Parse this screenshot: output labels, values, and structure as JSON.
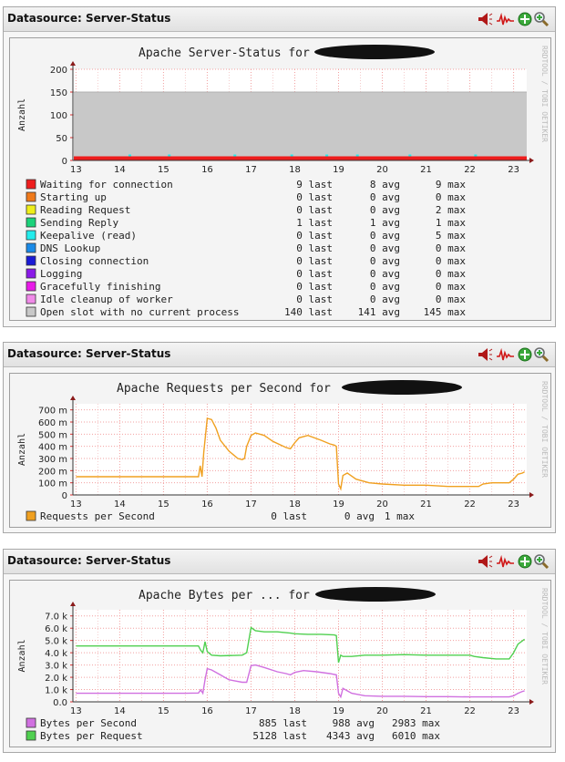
{
  "panels": [
    {
      "title": "Datasource: Server-Status",
      "graph_title": "Apache Server-Status for ",
      "watermark": "RRDTOOL / TOBI OETIKER",
      "chart_data": {
        "type": "area",
        "title": "Apache Server-Status for ",
        "ylabel": "Anzahl",
        "x_ticks": [
          "13",
          "14",
          "15",
          "16",
          "17",
          "18",
          "19",
          "20",
          "21",
          "22",
          "23"
        ],
        "y_ticks": [
          "0",
          "50",
          "100",
          "150",
          "200"
        ],
        "ylim": [
          0,
          200
        ],
        "grid": true,
        "series": [
          {
            "name": "Waiting for connection",
            "color": "#ee1d1d",
            "last": "9",
            "avg": "8",
            "max": "9"
          },
          {
            "name": "Starting up",
            "color": "#f07a1a",
            "last": "0",
            "avg": "0",
            "max": "0"
          },
          {
            "name": "Reading Request",
            "color": "#eeee1a",
            "last": "0",
            "avg": "0",
            "max": "2"
          },
          {
            "name": "Sending Reply",
            "color": "#1ad27a",
            "last": "1",
            "avg": "1",
            "max": "1"
          },
          {
            "name": "Keepalive (read)",
            "color": "#22ecec",
            "last": "0",
            "avg": "0",
            "max": "5"
          },
          {
            "name": "DNS Lookup",
            "color": "#1a8ae8",
            "last": "0",
            "avg": "0",
            "max": "0"
          },
          {
            "name": "Closing connection",
            "color": "#1a1ad6",
            "last": "0",
            "avg": "0",
            "max": "0"
          },
          {
            "name": "Logging",
            "color": "#8a1ae8",
            "last": "0",
            "avg": "0",
            "max": "0"
          },
          {
            "name": "Gracefully finishing",
            "color": "#e81ae8",
            "last": "0",
            "avg": "0",
            "max": "0"
          },
          {
            "name": "Idle cleanup of worker",
            "color": "#f08ae8",
            "last": "0",
            "avg": "0",
            "max": "0"
          },
          {
            "name": "Open slot with no current process",
            "color": "#c8c8c8",
            "last": "140",
            "avg": "141",
            "max": "145"
          }
        ],
        "open_slot_level": 150,
        "waiting_level": 9
      }
    },
    {
      "title": "Datasource: Server-Status",
      "graph_title": "Apache Requests per Second for ",
      "watermark": "RRDTOOL / TOBI OETIKER",
      "chart_data": {
        "type": "line",
        "title": "Apache Requests per Second for ",
        "ylabel": "Anzahl",
        "x_ticks": [
          "13",
          "14",
          "15",
          "16",
          "17",
          "18",
          "19",
          "20",
          "21",
          "22",
          "23"
        ],
        "y_ticks": [
          "0",
          "100 m",
          "200 m",
          "300 m",
          "400 m",
          "500 m",
          "600 m",
          "700 m"
        ],
        "ylim": [
          0,
          0.75
        ],
        "grid": true,
        "series": [
          {
            "name": "Requests per Second",
            "color": "#f0a020",
            "last": "0",
            "avg": "0",
            "max": "1",
            "x": [
              13,
              13.5,
              14,
              14.5,
              15,
              15.5,
              15.8,
              15.84,
              15.88,
              15.92,
              16.0,
              16.1,
              16.2,
              16.3,
              16.5,
              16.7,
              16.8,
              16.85,
              16.9,
              17.0,
              17.1,
              17.3,
              17.5,
              17.8,
              17.9,
              18.0,
              18.1,
              18.3,
              18.6,
              18.8,
              18.9,
              18.95,
              19.0,
              19.05,
              19.1,
              19.2,
              19.4,
              19.7,
              20.0,
              20.5,
              21.0,
              21.5,
              22.0,
              22.2,
              22.3,
              22.5,
              22.9,
              23.0,
              23.1,
              23.2,
              23.25
            ],
            "values": [
              0.15,
              0.15,
              0.15,
              0.15,
              0.15,
              0.15,
              0.15,
              0.24,
              0.15,
              0.35,
              0.63,
              0.62,
              0.55,
              0.45,
              0.36,
              0.3,
              0.29,
              0.3,
              0.4,
              0.49,
              0.51,
              0.49,
              0.44,
              0.39,
              0.38,
              0.43,
              0.47,
              0.49,
              0.45,
              0.42,
              0.41,
              0.4,
              0.09,
              0.05,
              0.16,
              0.18,
              0.13,
              0.1,
              0.09,
              0.08,
              0.08,
              0.07,
              0.07,
              0.07,
              0.09,
              0.1,
              0.1,
              0.13,
              0.17,
              0.18,
              0.19
            ]
          }
        ]
      }
    },
    {
      "title": "Datasource: Server-Status",
      "graph_title": "Apache Bytes per ... for ",
      "watermark": "RRDTOOL / TOBI OETIKER",
      "chart_data": {
        "type": "line",
        "title": "Apache Bytes per ... for ",
        "ylabel": "Anzahl",
        "x_ticks": [
          "13",
          "14",
          "15",
          "16",
          "17",
          "18",
          "19",
          "20",
          "21",
          "22",
          "23"
        ],
        "y_ticks": [
          "0.0",
          "1.0 k",
          "2.0 k",
          "3.0 k",
          "4.0 k",
          "5.0 k",
          "6.0 k",
          "7.0 k"
        ],
        "ylim": [
          0,
          7500
        ],
        "grid": true,
        "series": [
          {
            "name": "Bytes per Second",
            "color": "#d070e0",
            "last": "885",
            "avg": "988",
            "max": "2983",
            "x": [
              13,
              13.5,
              14,
              14.5,
              15,
              15.5,
              15.8,
              15.85,
              15.9,
              15.95,
              16.0,
              16.1,
              16.3,
              16.5,
              16.8,
              16.9,
              17.0,
              17.1,
              17.3,
              17.6,
              17.8,
              17.9,
              18.0,
              18.2,
              18.5,
              18.8,
              18.95,
              19.0,
              19.05,
              19.1,
              19.3,
              19.6,
              20.0,
              20.5,
              21.0,
              21.5,
              22.0,
              22.5,
              22.9,
              23.0,
              23.1,
              23.2,
              23.25
            ],
            "values": [
              700,
              700,
              700,
              700,
              700,
              700,
              720,
              980,
              700,
              1800,
              2700,
              2600,
              2200,
              1800,
              1600,
              1600,
              2950,
              3000,
              2800,
              2450,
              2300,
              2200,
              2400,
              2550,
              2450,
              2300,
              2200,
              700,
              400,
              1100,
              700,
              500,
              450,
              450,
              420,
              420,
              400,
              400,
              400,
              500,
              700,
              850,
              900
            ]
          },
          {
            "name": "Bytes per Request",
            "color": "#50d050",
            "last": "5128",
            "avg": "4343",
            "max": "6010",
            "x": [
              13,
              13.5,
              14,
              14.5,
              15,
              15.5,
              15.8,
              15.85,
              15.9,
              15.95,
              16.0,
              16.1,
              16.3,
              16.8,
              16.9,
              17.0,
              17.1,
              17.3,
              17.6,
              17.9,
              18.0,
              18.3,
              18.6,
              18.9,
              18.95,
              19.0,
              19.05,
              19.1,
              19.3,
              19.6,
              20.0,
              20.5,
              21.0,
              21.5,
              22.0,
              22.1,
              22.3,
              22.6,
              22.9,
              23.0,
              23.1,
              23.25
            ],
            "values": [
              4550,
              4550,
              4550,
              4550,
              4550,
              4550,
              4550,
              4200,
              4000,
              4900,
              4100,
              3800,
              3750,
              3800,
              4000,
              6050,
              5800,
              5700,
              5700,
              5600,
              5550,
              5500,
              5500,
              5450,
              5400,
              3200,
              3800,
              3700,
              3700,
              3800,
              3800,
              3850,
              3800,
              3800,
              3800,
              3700,
              3600,
              3500,
              3500,
              4000,
              4700,
              5100
            ]
          }
        ]
      }
    }
  ]
}
